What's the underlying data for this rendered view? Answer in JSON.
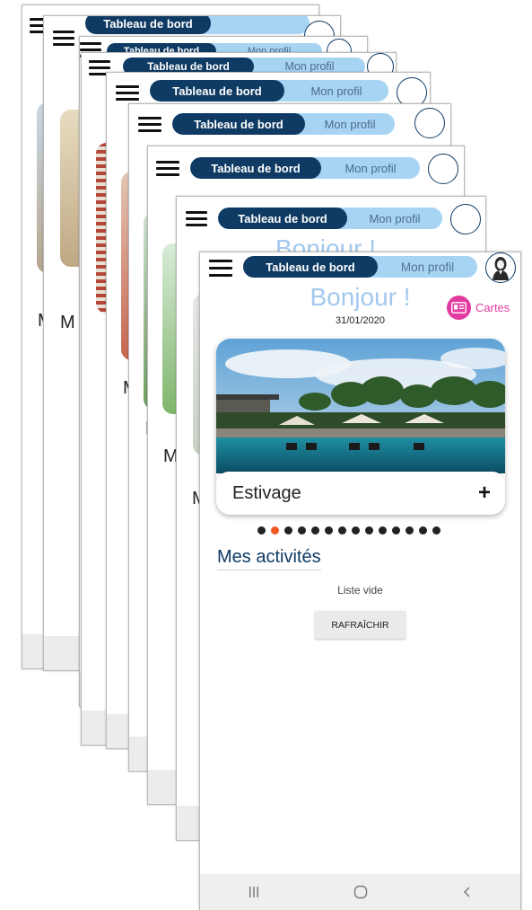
{
  "header": {
    "tab_dashboard": "Tableau de bord",
    "tab_profile": "Mon profil"
  },
  "greeting": "Bonjour !",
  "date": "31/01/2020",
  "cartes_label": "Cartes",
  "carousel": {
    "current_title": "Estivage",
    "add_icon": "+",
    "total_dots": 14,
    "active_index": 1
  },
  "activities": {
    "title": "Mes activités",
    "empty_text": "Liste vide",
    "refresh_label": "RAFRAÎCHIR"
  },
  "background_screens": {
    "greeting_fragment": "Bonjour !",
    "section_fragment": "M"
  },
  "navbar": {
    "recents_icon": "recents-icon",
    "home_icon": "home-icon",
    "back_icon": "back-icon"
  },
  "colors": {
    "navy": "#0e3a63",
    "light_blue": "#a8d4f4",
    "greeting_blue": "#a3c8ee",
    "pink": "#e23aa0",
    "active_dot": "#f05a22"
  }
}
